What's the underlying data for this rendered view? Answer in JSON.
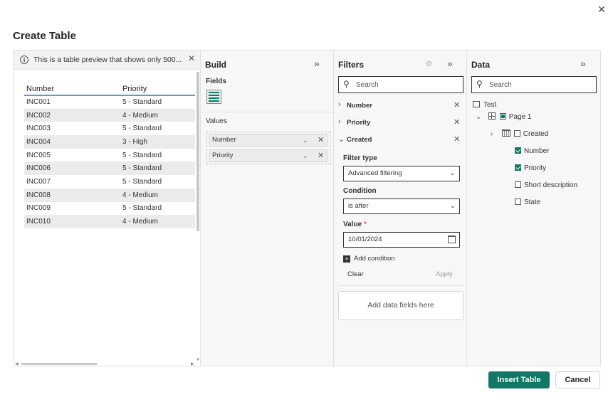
{
  "dialog": {
    "title": "Create Table",
    "close_glyph": "✕"
  },
  "preview": {
    "info_text": "This is a table preview that shows only 500...",
    "columns": [
      "Number",
      "Priority"
    ],
    "rows": [
      [
        "INC001",
        "5 - Standard"
      ],
      [
        "INC002",
        "4 - Medium"
      ],
      [
        "INC003",
        "5 - Standard"
      ],
      [
        "INC004",
        "3 - High"
      ],
      [
        "INC005",
        "5 - Standard"
      ],
      [
        "INC006",
        "5 - Standard"
      ],
      [
        "INC007",
        "5 - Standard"
      ],
      [
        "INC008",
        "4 - Medium"
      ],
      [
        "INC009",
        "5 - Standard"
      ],
      [
        "INC010",
        "4 - Medium"
      ]
    ]
  },
  "build": {
    "title": "Build",
    "fields_label": "Fields",
    "values_label": "Values",
    "value_fields": [
      "Number",
      "Priority"
    ]
  },
  "filters": {
    "title": "Filters",
    "search_placeholder": "Search",
    "items": [
      "Number",
      "Priority",
      "Created"
    ],
    "filter_type_label": "Filter type",
    "filter_type_value": "Advanced filtering",
    "condition_label": "Condition",
    "condition_value": "is after",
    "value_label": "Value",
    "required_mark": "*",
    "value_value": "10/01/2024",
    "add_condition": "Add condition",
    "clear": "Clear",
    "apply": "Apply",
    "add_data_fields": "Add data fields here"
  },
  "data": {
    "title": "Data",
    "search_placeholder": "Search",
    "root": "Test",
    "page": "Page 1",
    "fields": [
      {
        "label": "Created",
        "checked": false
      },
      {
        "label": "Number",
        "checked": true
      },
      {
        "label": "Priority",
        "checked": true
      },
      {
        "label": "Short description",
        "checked": false
      },
      {
        "label": "State",
        "checked": false
      }
    ]
  },
  "footer": {
    "insert_label": "Insert Table",
    "cancel_label": "Cancel"
  },
  "colors": {
    "accent": "#117865",
    "header_underline": "#5b9bd5"
  }
}
